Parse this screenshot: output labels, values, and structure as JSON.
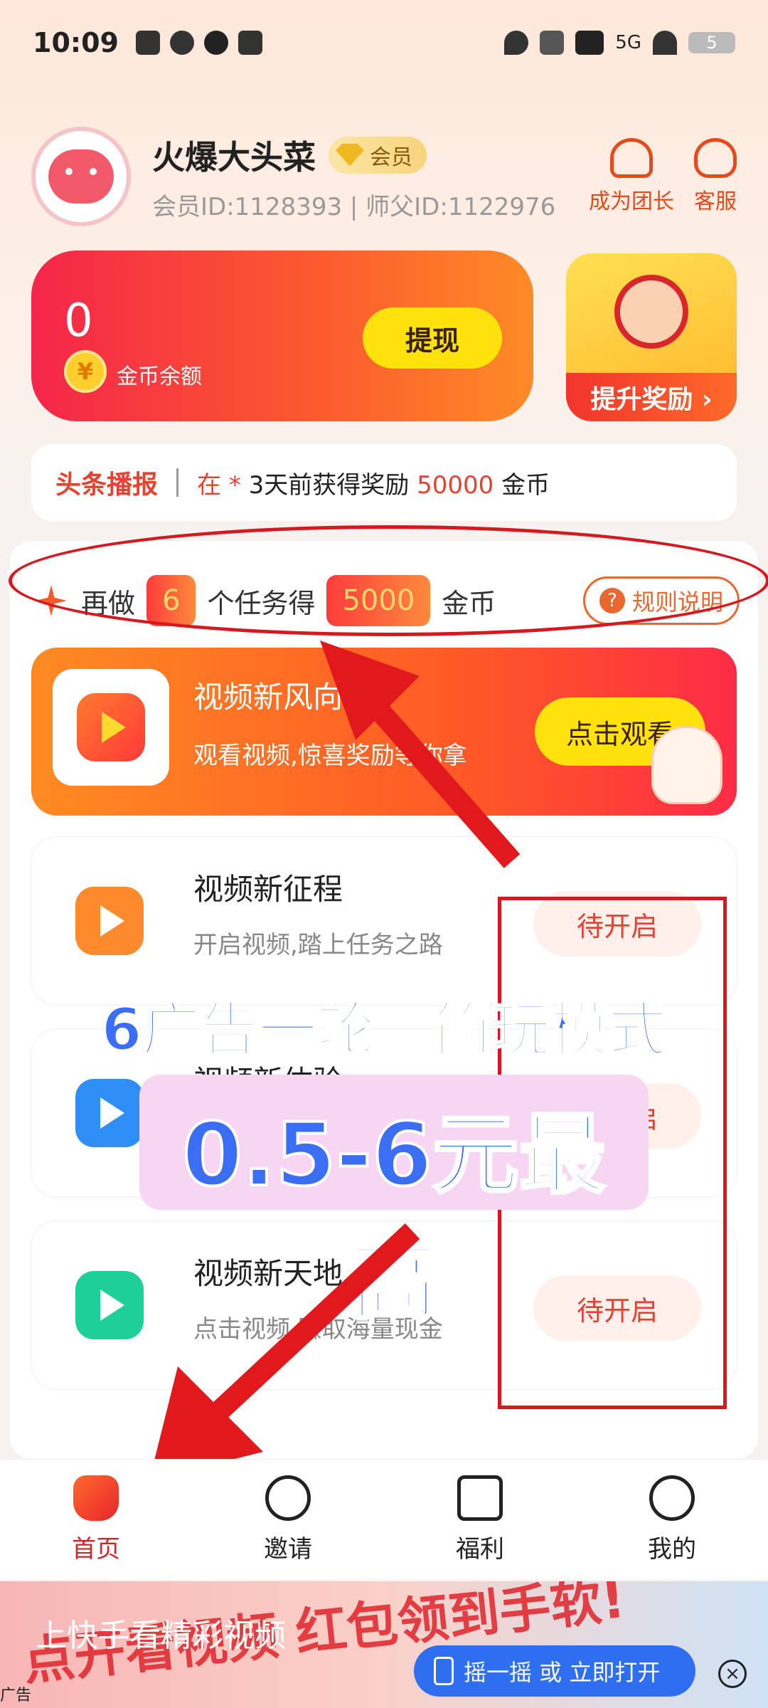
{
  "status_bar": {
    "time": "10:09",
    "network": "5G",
    "battery": "5"
  },
  "profile": {
    "name": "火爆大头菜",
    "vip_label": "会员",
    "ids": "会员ID:1128393 | 师父ID:1122976",
    "actions": [
      {
        "label": "成为团长",
        "icon": "team-icon"
      },
      {
        "label": "客服",
        "icon": "headset-icon"
      }
    ]
  },
  "balance": {
    "value": "0",
    "coin_symbol": "¥",
    "label": "金币余额",
    "withdraw_label": "提现"
  },
  "reward_tile": {
    "label": "提升奖励 ›"
  },
  "ticker": {
    "title": "头条播报",
    "prefix": "在 * ",
    "text": "3天前获得奖励 ",
    "amount": "50000",
    "suffix": " 金币"
  },
  "task_goal": {
    "part1": "再做",
    "count": "6",
    "part2": "个任务得",
    "reward": "5000",
    "part3": "金币",
    "rules_label": "规则说明"
  },
  "featured_task": {
    "title": "视频新风向",
    "subtitle": "观看视频,惊喜奖励等你拿",
    "button": "点击观看"
  },
  "tasks": [
    {
      "title": "视频新征程",
      "subtitle": "开启视频,踏上任务之路",
      "button": "待开启",
      "color": "#ff8a2e"
    },
    {
      "title": "视频新体验",
      "subtitle": "",
      "button": "待开启",
      "color": "#2e8ef5"
    },
    {
      "title": "视频新天地",
      "subtitle": "点击视频,赚取海量现金",
      "button": "待开启",
      "color": "#1fcf9a"
    }
  ],
  "overlay": {
    "line1": "6广告一轮。简玩模式",
    "line2": "0.5-6元最高"
  },
  "bottom_nav": [
    {
      "label": "首页",
      "active": true
    },
    {
      "label": "邀请",
      "active": false
    },
    {
      "label": "福利",
      "active": false
    },
    {
      "label": "我的",
      "active": false
    }
  ],
  "ad": {
    "big_text": "点开看视频 红包领到手软!",
    "title": "上快手看精彩视频",
    "cta": "摇一摇 或 立即打开",
    "tag": "广告",
    "close": "×"
  },
  "colors": {
    "accent": "#e8412f",
    "annotation_red": "#d7191f",
    "overlay_blue": "#3a6ef5"
  }
}
